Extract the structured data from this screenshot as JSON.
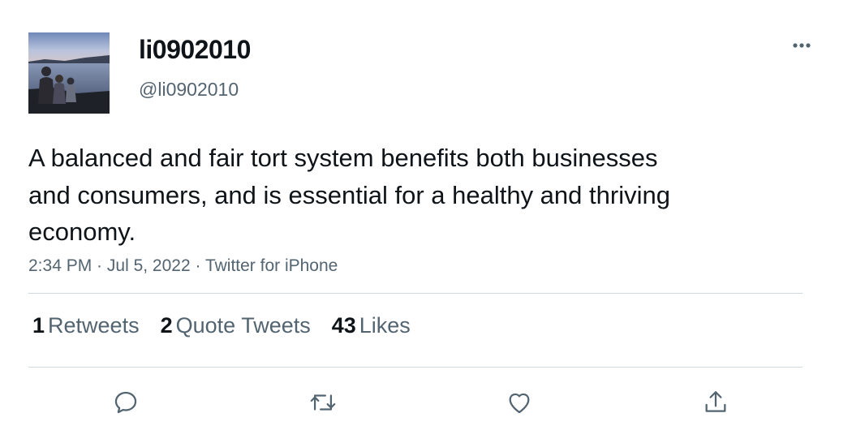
{
  "tweet": {
    "display_name": "li0902010",
    "handle": "@li0902010",
    "text": "A balanced and fair tort system benefits both businesses and consumers, and is essential for a healthy and thriving economy.",
    "time": "2:34 PM",
    "date": "Jul 5, 2022",
    "source": "Twitter for iPhone",
    "separator": " · "
  },
  "stats": {
    "retweets_count": "1",
    "retweets_label": "Retweets",
    "quotes_count": "2",
    "quotes_label": "Quote Tweets",
    "likes_count": "43",
    "likes_label": "Likes"
  },
  "icons": {
    "more": "more-horizontal-icon",
    "reply": "reply-icon",
    "retweet": "retweet-icon",
    "like": "heart-icon",
    "share": "share-icon"
  },
  "colors": {
    "text": "#0f1419",
    "secondary": "#536471",
    "divider": "#cfd9de",
    "background": "#ffffff"
  }
}
